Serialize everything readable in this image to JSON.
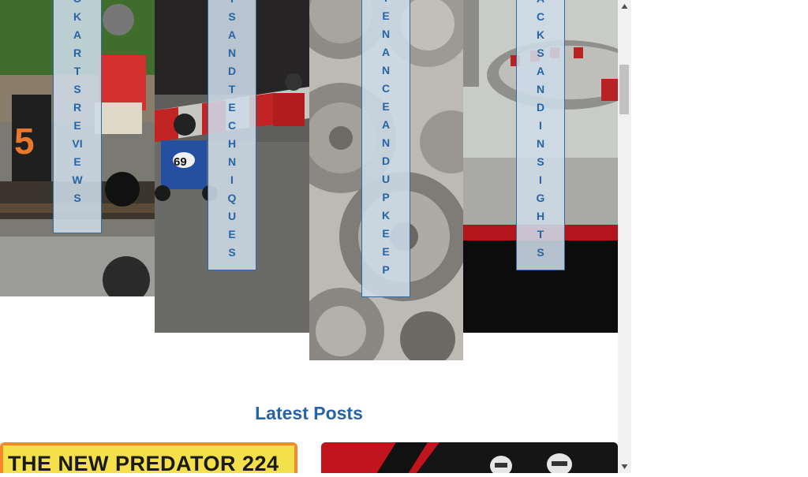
{
  "categories": [
    {
      "label_letters": [
        "O",
        "K",
        "A",
        "R",
        "T",
        "S",
        "R",
        "E",
        "VI",
        "E",
        "W",
        "S"
      ]
    },
    {
      "label_letters": [
        "T",
        "S",
        "A",
        "N",
        "D",
        "T",
        "E",
        "C",
        "H",
        "N",
        "I",
        "Q",
        "U",
        "E",
        "S"
      ]
    },
    {
      "label_letters": [
        "T",
        "E",
        "N",
        "A",
        "N",
        "C",
        "E",
        "A",
        "N",
        "D",
        "U",
        "P",
        "K",
        "E",
        "E",
        "P"
      ]
    },
    {
      "label_letters": [
        "A",
        "C",
        "K",
        "S",
        "A",
        "N",
        "D",
        "I",
        "N",
        "S",
        "I",
        "G",
        "H",
        "T",
        "S"
      ]
    }
  ],
  "latest_posts": {
    "title": "Latest Posts",
    "posts": [
      {
        "headline": "THE NEW PREDATOR 224"
      },
      {
        "headline": ""
      }
    ]
  },
  "colors": {
    "accent": "#2764a6",
    "label_bg": "#cddce8"
  },
  "icons": {
    "scroll_up": "triangle-up-icon",
    "scroll_down": "triangle-down-icon"
  }
}
